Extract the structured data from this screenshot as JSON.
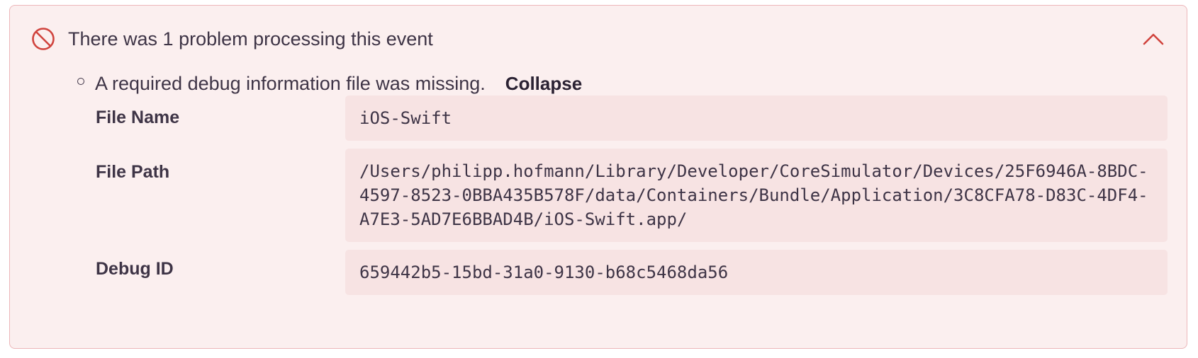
{
  "header": {
    "title": "There was 1 problem processing this event",
    "icon": "error-circle-slash-icon",
    "toggle_icon": "chevron-up-icon"
  },
  "problem": {
    "message": "A required debug information file was missing.",
    "collapse_label": "Collapse"
  },
  "details": [
    {
      "label": "File Name",
      "value": "iOS-Swift"
    },
    {
      "label": "File Path",
      "value": "/Users/philipp.hofmann/Library/Developer/CoreSimulator/Devices/25F6946A-8BDC-4597-8523-0BBA435B578F/data/Containers/Bundle/Application/3C8CFA78-D83C-4DF4-A7E3-5AD7E6BBAD4B/iOS-Swift.app/"
    },
    {
      "label": "Debug ID",
      "value": "659442b5-15bd-31a0-9130-b68c5468da56"
    }
  ],
  "colors": {
    "accent_error": "#d0433d",
    "panel_background": "#fbefef",
    "panel_border": "#ecb6b9",
    "value_background": "#f7e3e3",
    "text": "#3e3446"
  }
}
